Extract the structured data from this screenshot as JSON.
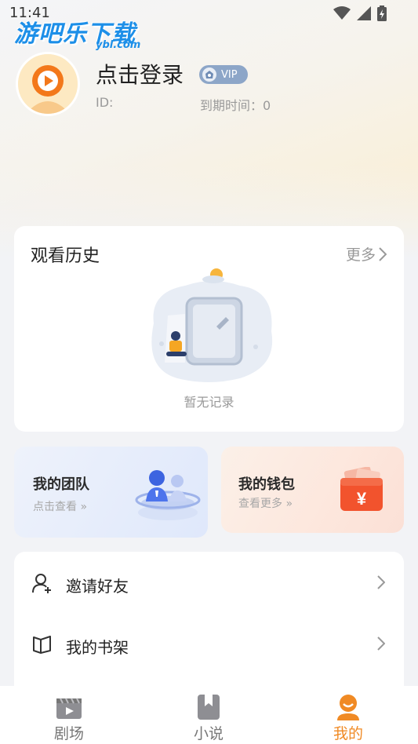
{
  "status_bar": {
    "time": "11:41"
  },
  "watermark": {
    "text": "游吧乐下载",
    "sub": "ybl.com"
  },
  "profile": {
    "title": "点击登录",
    "vip_label": "VIP",
    "id_label": "ID:",
    "expiry_label": "到期时间：0"
  },
  "history": {
    "title": "观看历史",
    "more": "更多",
    "empty_text": "暂无记录"
  },
  "features": {
    "team": {
      "title": "我的团队",
      "sub": "点击查看 »"
    },
    "wallet": {
      "title": "我的钱包",
      "sub": "查看更多 »"
    }
  },
  "menu": [
    {
      "label": "邀请好友",
      "icon": "user-plus-icon"
    },
    {
      "label": "我的书架",
      "icon": "book-open-icon"
    }
  ],
  "nav": [
    {
      "label": "剧场",
      "icon": "video-icon",
      "active": false
    },
    {
      "label": "小说",
      "icon": "bookmark-book-icon",
      "active": false
    },
    {
      "label": "我的",
      "icon": "profile-icon",
      "active": true
    }
  ],
  "colors": {
    "accent": "#f08a24",
    "vip": "#8da6c8",
    "watermark": "#1d8fe8"
  }
}
